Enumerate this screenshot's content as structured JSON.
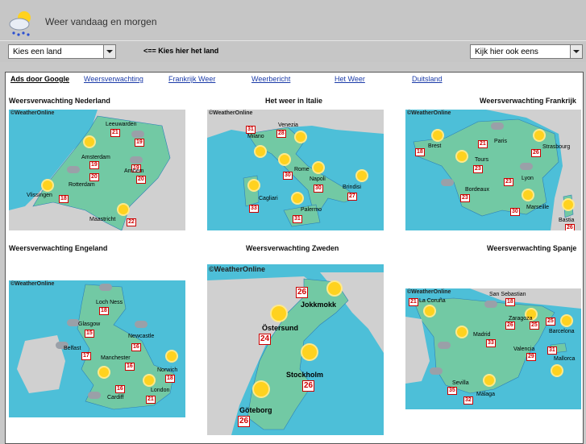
{
  "header": {
    "title": "Weer vandaag en morgen"
  },
  "toolbar": {
    "country_select": "Kies een land",
    "hint": "<== Kies hier het land",
    "also_select": "Kijk hier ook eens"
  },
  "links": [
    "Ads door Google",
    "Weersverwachting",
    "Frankrijk Weer",
    "Weerbericht",
    "Het Weer",
    "Duitsland"
  ],
  "watermark": "©WeatherOnline",
  "maps": [
    {
      "title": "Weersverwachting Nederland",
      "cities": [
        {
          "name": "Leeuwarden",
          "t": "21"
        },
        {
          "name": "Amsterdam",
          "t": "19"
        },
        {
          "name": "Rotterdam",
          "t": "20"
        },
        {
          "name": "Arnhem",
          "t": "20"
        },
        {
          "name": "Vlissingen",
          "t": "18"
        },
        {
          "name": "Maastricht",
          "t": "22"
        }
      ],
      "extra_temps": [
        "19",
        "19"
      ]
    },
    {
      "title": "Het weer in Italie",
      "cities": [
        {
          "name": "Milano",
          "t": "31"
        },
        {
          "name": "Venezia",
          "t": "28"
        },
        {
          "name": "Rome",
          "t": "30"
        },
        {
          "name": "Napoli",
          "t": "30"
        },
        {
          "name": "Brindisi",
          "t": "27"
        },
        {
          "name": "Cagliari",
          "t": "33"
        },
        {
          "name": "Palermo",
          "t": "31"
        }
      ]
    },
    {
      "title": "Weersverwachting Frankrijk",
      "cities": [
        {
          "name": "Brest",
          "t": "18"
        },
        {
          "name": "Paris",
          "t": "21"
        },
        {
          "name": "Strasbourg",
          "t": "26"
        },
        {
          "name": "Tours",
          "t": "23"
        },
        {
          "name": "Lyon",
          "t": "23"
        },
        {
          "name": "Bordeaux",
          "t": "23"
        },
        {
          "name": "Marseille",
          "t": "30"
        },
        {
          "name": "Bastia",
          "t": "26"
        }
      ]
    },
    {
      "title": "Weersverwachting Engeland",
      "cities": [
        {
          "name": "Loch Ness",
          "t": "18"
        },
        {
          "name": "Glasgow",
          "t": "15"
        },
        {
          "name": "Newcastle",
          "t": "16"
        },
        {
          "name": "Belfast",
          "t": "17"
        },
        {
          "name": "Manchester",
          "t": "16"
        },
        {
          "name": "Norwich",
          "t": "18"
        },
        {
          "name": "Cardiff",
          "t": "16"
        },
        {
          "name": "London",
          "t": "21"
        }
      ]
    },
    {
      "title": "Weersverwachting Zweden",
      "cities": [
        {
          "name": "Jokkmokk",
          "t": "26"
        },
        {
          "name": "Östersund",
          "t": "24"
        },
        {
          "name": "Stockholm",
          "t": "26"
        },
        {
          "name": "Göteborg",
          "t": "26"
        }
      ]
    },
    {
      "title": "Weersverwachting Spanje",
      "cities": [
        {
          "name": "La Coruña",
          "t": "21"
        },
        {
          "name": "San Sebastian",
          "t": "18"
        },
        {
          "name": "Zaragoza",
          "t": "26"
        },
        {
          "name": "Barcelona",
          "t": "25"
        },
        {
          "name": "Madrid",
          "t": "33"
        },
        {
          "name": "Valencia",
          "t": "29"
        },
        {
          "name": "Mallorca",
          "t": "31"
        },
        {
          "name": "Sevilla",
          "t": "35"
        },
        {
          "name": "Málaga",
          "t": "32"
        }
      ],
      "extra_temps": [
        "25"
      ]
    }
  ],
  "colors": {
    "sea": "#4dbfd8",
    "land": "#72c9a4",
    "neighbour": "#d0d0d0",
    "temp": "#d00000"
  }
}
